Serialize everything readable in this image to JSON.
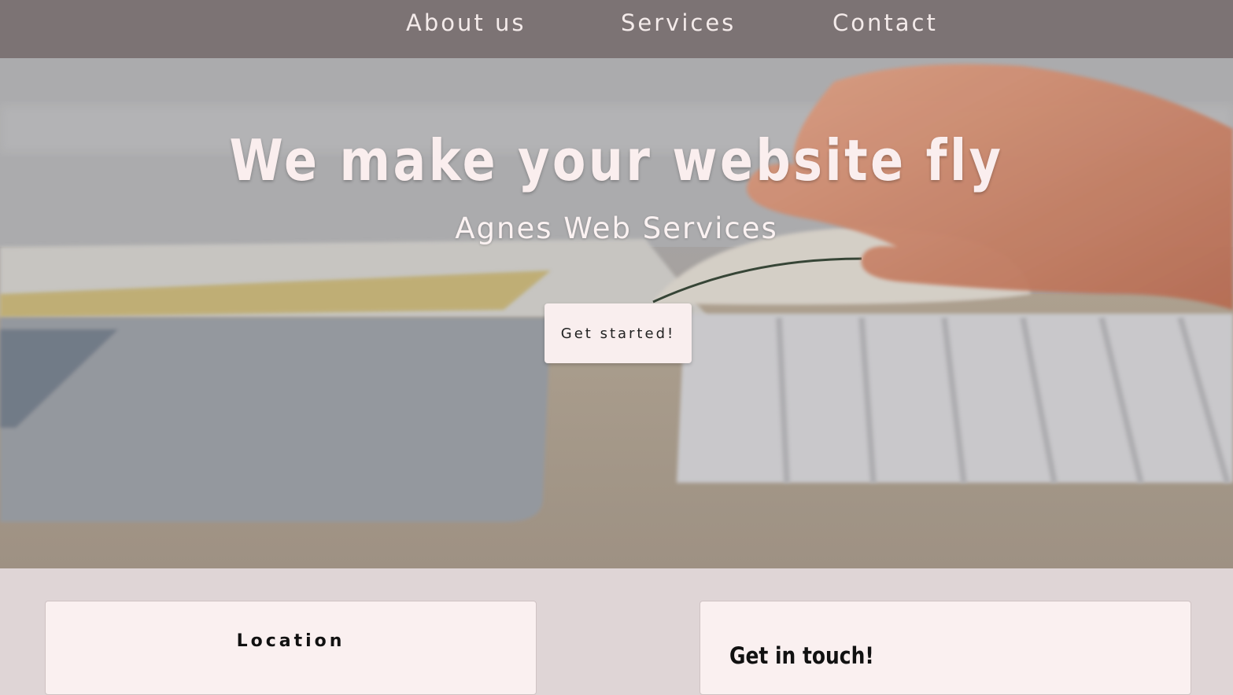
{
  "nav": {
    "items": [
      {
        "label": "About us"
      },
      {
        "label": "Services"
      },
      {
        "label": "Contact"
      }
    ]
  },
  "hero": {
    "title": "We make your website fly",
    "subtitle": "Agnes Web Services",
    "cta_label": "Get started!"
  },
  "cards": {
    "location": {
      "heading": "Location"
    },
    "contact": {
      "heading": "Get in touch!"
    }
  },
  "colors": {
    "nav_background": "#7c7374",
    "page_background": "#dfd5d6",
    "card_background": "#faf0f0",
    "hero_text": "#faeeee"
  }
}
